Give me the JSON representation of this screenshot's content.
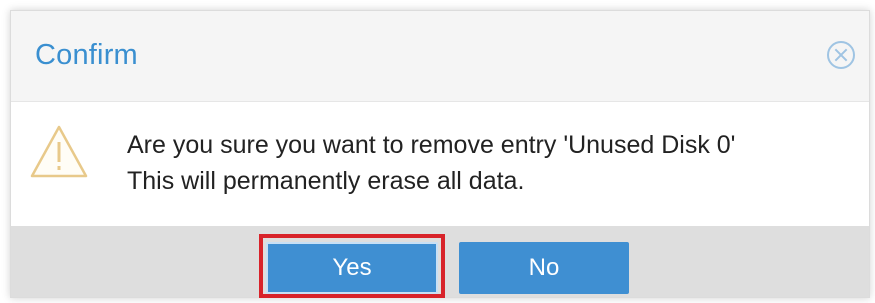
{
  "dialog": {
    "title": "Confirm",
    "close_icon": "close-circle-icon",
    "warning_icon": "warning-triangle-icon",
    "message_line1": "Are you sure you want to remove entry 'Unused Disk 0'",
    "message_line2": "This will permanently erase all data.",
    "buttons": {
      "yes_label": "Yes",
      "no_label": "No"
    }
  },
  "colors": {
    "accent": "#3f8fd2",
    "title": "#3a8fd0",
    "highlight": "#d8232a",
    "warning": "#e8c98a"
  }
}
